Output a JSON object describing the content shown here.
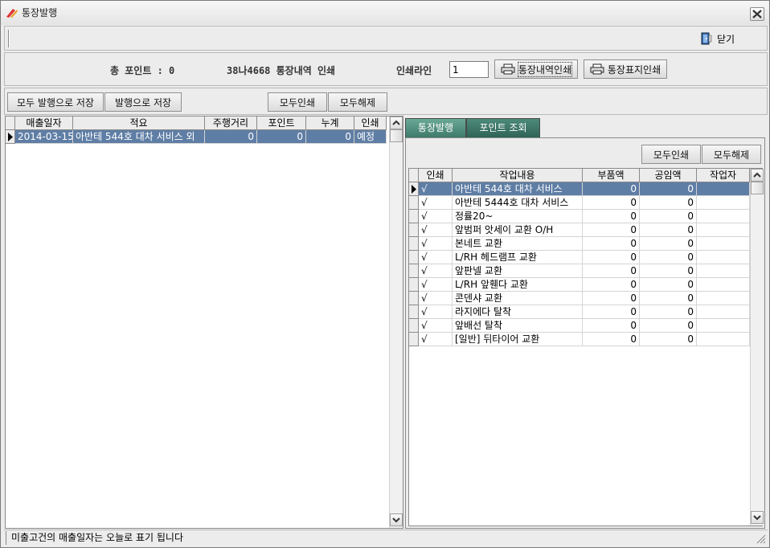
{
  "window": {
    "title": "통장발행",
    "close_icon": "close-x-icon"
  },
  "toolbar": {
    "close_label": "닫기"
  },
  "info": {
    "total_points_label": "총 포인트 : 0",
    "passbook_title": "38나4668 통장내역 인쇄",
    "print_line_label": "인쇄라인",
    "print_line_value": "1",
    "print_history_button": "통장내역인쇄",
    "print_cover_button": "통장표지인쇄"
  },
  "actions": {
    "save_all_issued": "모두 발행으로 저장",
    "save_issued": "발행으로 저장",
    "print_all": "모두인쇄",
    "clear_all": "모두해제"
  },
  "sales_grid": {
    "columns": [
      "매출일자",
      "적요",
      "주행거리",
      "포인트",
      "누계",
      "인쇄"
    ],
    "rows": [
      {
        "date": "2014-03-15",
        "desc": "아반테 544호 대차 서비스 외",
        "mileage": "0",
        "point": "0",
        "total": "0",
        "print": "예정"
      }
    ]
  },
  "tabs": {
    "issue": "통장발행",
    "point_inquiry": "포인트 조회"
  },
  "right_actions": {
    "print_all": "모두인쇄",
    "clear_all": "모두해제"
  },
  "work_grid": {
    "columns": [
      "인쇄",
      "작업내용",
      "부품액",
      "공임액",
      "작업자"
    ],
    "rows": [
      {
        "print": "√",
        "work": "아반테 544호 대차 서비스",
        "parts": "0",
        "labor": "0",
        "worker": ""
      },
      {
        "print": "√",
        "work": "아반테 5444호 대차 서비스",
        "parts": "0",
        "labor": "0",
        "worker": ""
      },
      {
        "print": "√",
        "work": "정률20~",
        "parts": "0",
        "labor": "0",
        "worker": ""
      },
      {
        "print": "√",
        "work": "앞범퍼 앗세이 교환 O/H",
        "parts": "0",
        "labor": "0",
        "worker": ""
      },
      {
        "print": "√",
        "work": "본네트 교환",
        "parts": "0",
        "labor": "0",
        "worker": ""
      },
      {
        "print": "√",
        "work": "L/RH 헤드램프 교환",
        "parts": "0",
        "labor": "0",
        "worker": ""
      },
      {
        "print": "√",
        "work": "앞판넬 교환",
        "parts": "0",
        "labor": "0",
        "worker": ""
      },
      {
        "print": "√",
        "work": "L/RH 앞휀다 교환",
        "parts": "0",
        "labor": "0",
        "worker": ""
      },
      {
        "print": "√",
        "work": "콘덴샤 교환",
        "parts": "0",
        "labor": "0",
        "worker": ""
      },
      {
        "print": "√",
        "work": "라지에다 탈착",
        "parts": "0",
        "labor": "0",
        "worker": ""
      },
      {
        "print": "√",
        "work": "앞배선 탈착",
        "parts": "0",
        "labor": "0",
        "worker": ""
      },
      {
        "print": "√",
        "work": "[일반] 뒤타이어 교환",
        "parts": "0",
        "labor": "0",
        "worker": ""
      }
    ]
  },
  "status": {
    "message": "미출고건의 매출일자는 오늘로 표기 됩니다"
  },
  "colors": {
    "selected_row": "#5f7ea5",
    "tab": "#4e8a7b"
  }
}
